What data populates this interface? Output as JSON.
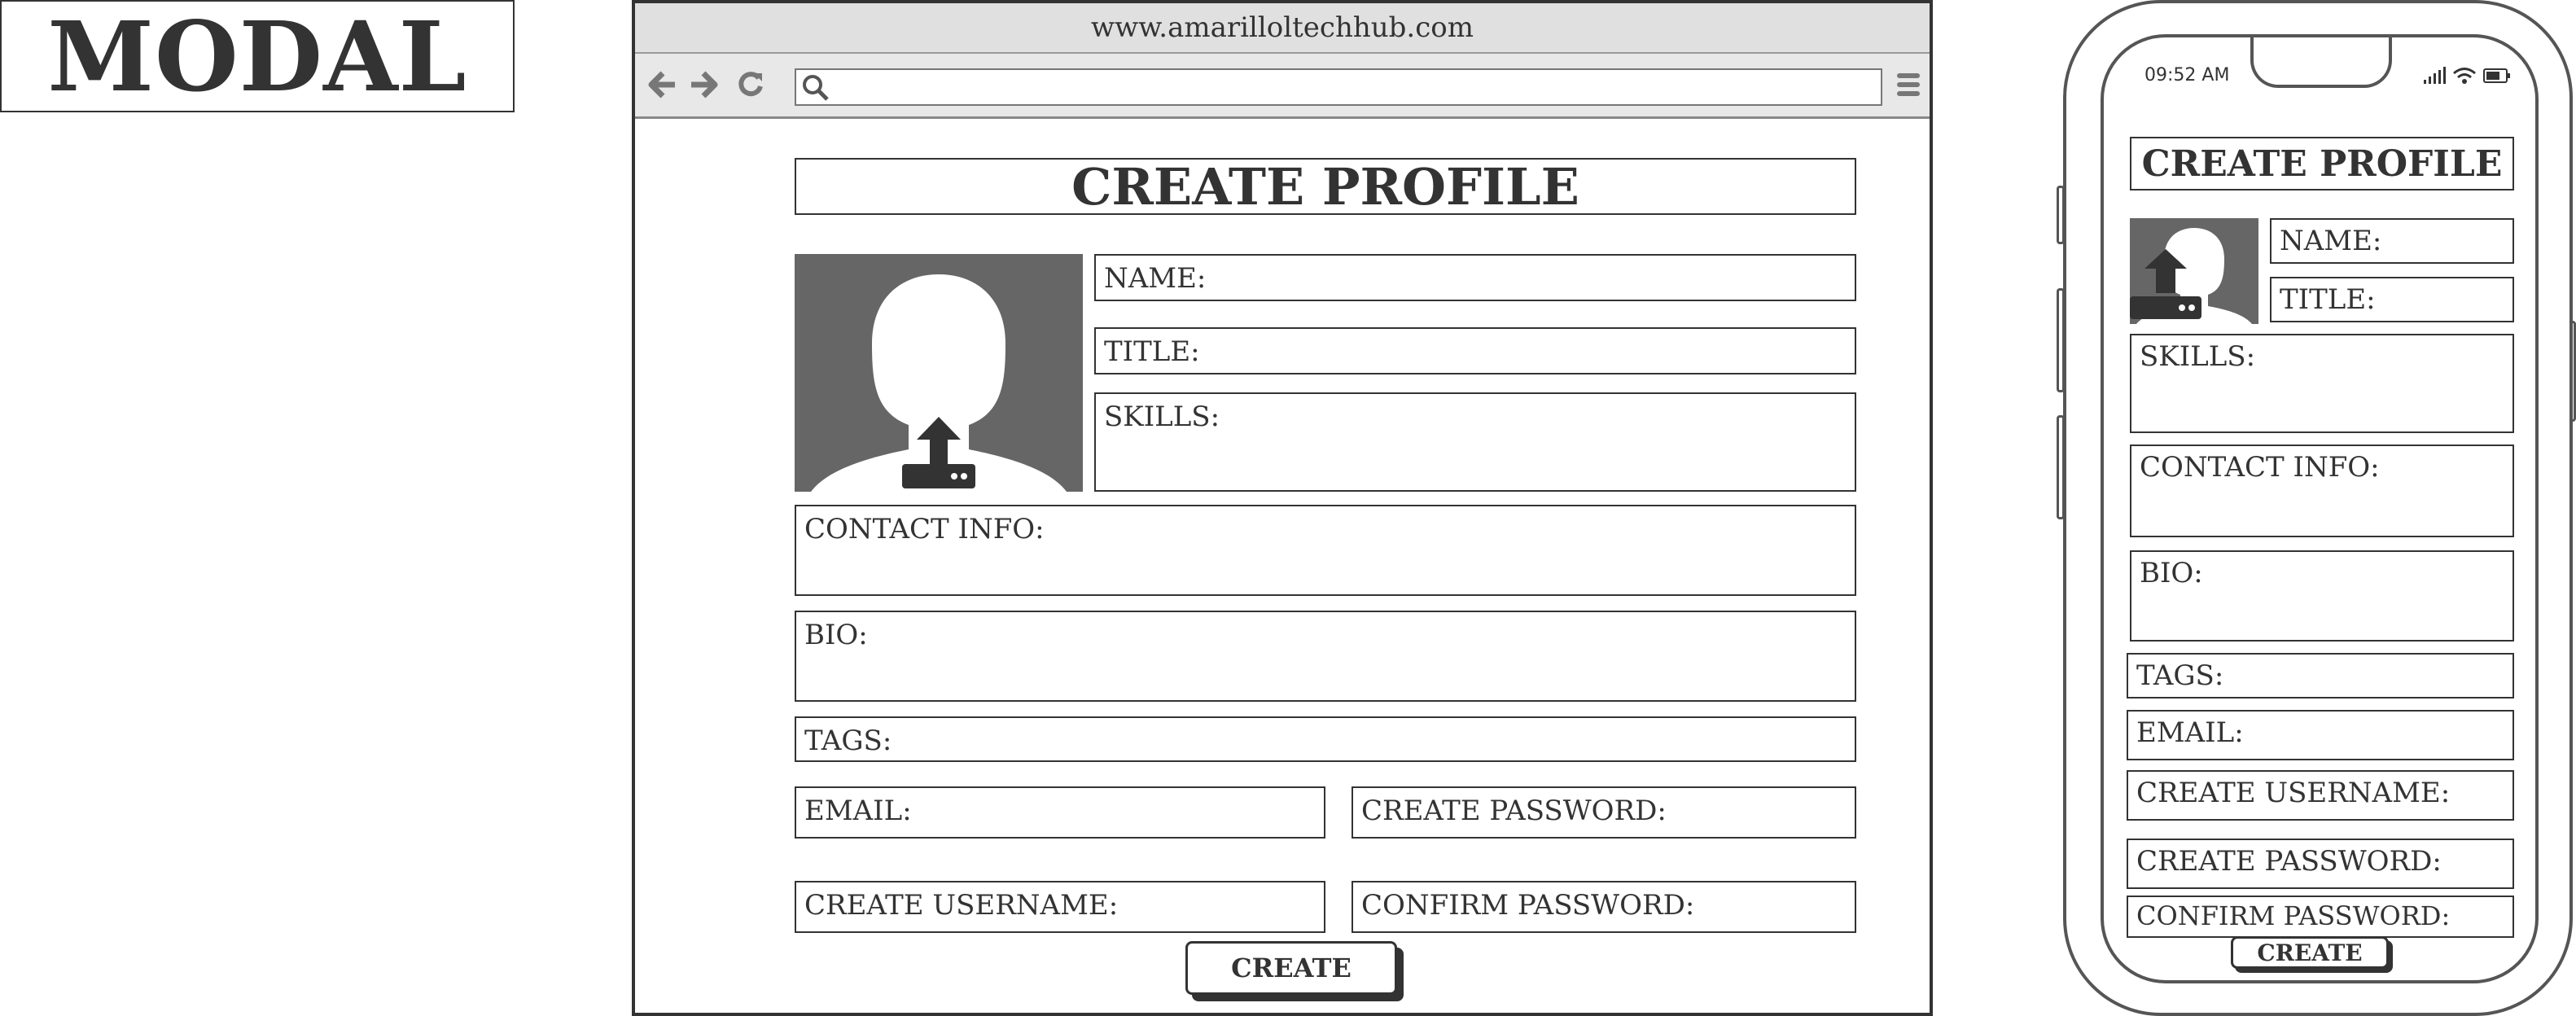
{
  "label": {
    "text": "MODAL"
  },
  "browser": {
    "url": "www.amarilloltechhub.com",
    "form": {
      "heading": "CREATE PROFILE",
      "fields": {
        "name": "NAME:",
        "title": "TITLE:",
        "skills": "SKILLS:",
        "contact": "CONTACT INFO:",
        "bio": "BIO:",
        "tags": "TAGS:",
        "email": "EMAIL:",
        "create_password": "CREATE PASSWORD:",
        "create_username": "CREATE USERNAME:",
        "confirm_password": "CONFIRM PASSWORD:"
      },
      "submit_label": "CREATE"
    }
  },
  "phone": {
    "status_time": "09:52 AM",
    "form": {
      "heading": "CREATE PROFILE",
      "fields": {
        "name": "NAME:",
        "title": "TITLE:",
        "skills": "SKILLS:",
        "contact": "CONTACT INFO:",
        "bio": "BIO:",
        "tags": "TAGS:",
        "email": "EMAIL:",
        "create_username": "CREATE USERNAME:",
        "create_password": "CREATE PASSWORD:",
        "confirm_password": "CONFIRM PASSWORD:"
      },
      "submit_label": "CREATE"
    }
  },
  "icons": {
    "back": "arrow-left-icon",
    "forward": "arrow-right-icon",
    "reload": "reload-icon",
    "search": "search-icon",
    "menu": "hamburger-menu-icon",
    "avatar": "avatar-placeholder",
    "upload": "upload-icon",
    "signal": "signal-icon",
    "wifi": "wifi-icon",
    "battery": "battery-icon"
  },
  "colors": {
    "ink": "#333333",
    "chrome": "#e0e0e0",
    "avatar_bg": "#666666"
  }
}
